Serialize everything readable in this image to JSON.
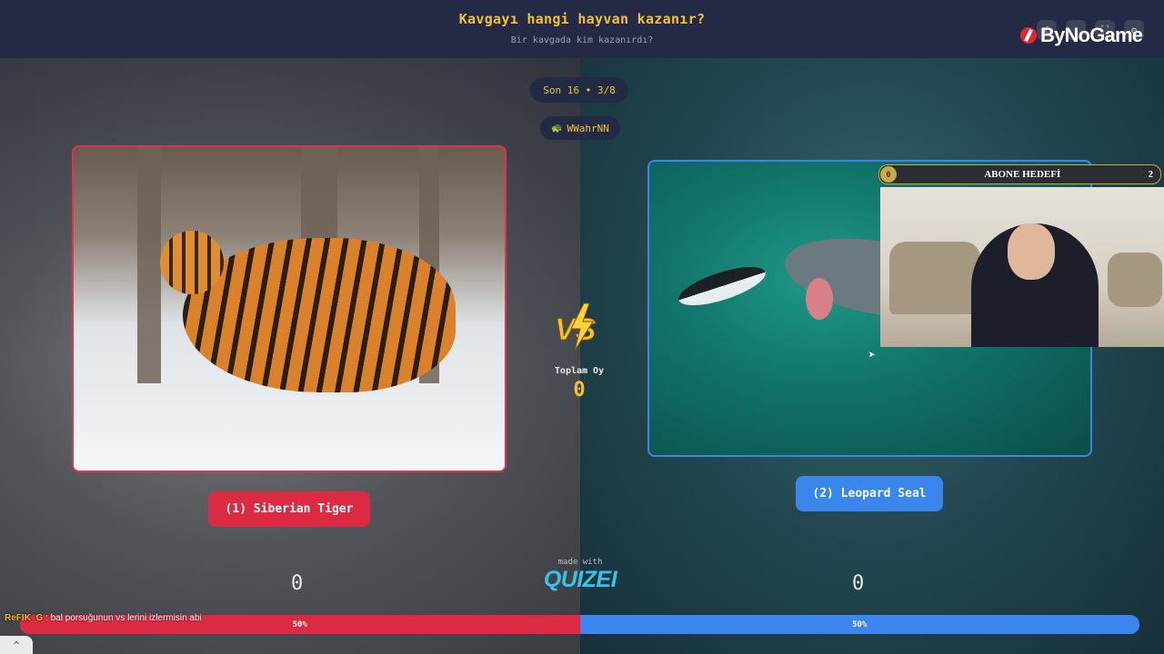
{
  "header": {
    "title": "Kavgayı hangi hayvan kazanır?",
    "subtitle": "Bir kavgada kim kazanırdı?",
    "brand": "ByNoGame"
  },
  "round": {
    "label": "Son 16 • 3/8"
  },
  "user": {
    "name": "WWahrNN",
    "icon": "user-badge-icon"
  },
  "left": {
    "choice_label": "(1) Siberian Tiger",
    "votes": "0",
    "percent": "50%",
    "color": "#dd2a43"
  },
  "right": {
    "choice_label": "(2) Leopard Seal",
    "votes": "0",
    "percent": "50%",
    "color": "#3a86ec"
  },
  "center": {
    "vs_label": "VS",
    "total_label": "Toplam Oy",
    "total_value": "0"
  },
  "footer": {
    "made_with": "made with",
    "made_with_brand": "QUIZEI"
  },
  "chat": {
    "username": "ReFIK_G",
    "message": " : bal porsuğunun vs lerini izlermisin abi"
  },
  "overlay": {
    "goal_label": "ABONE HEDEFİ",
    "goal_current": "0",
    "goal_target": "2"
  },
  "colors": {
    "accent": "#f2c233",
    "header_bg": "#242a45"
  }
}
